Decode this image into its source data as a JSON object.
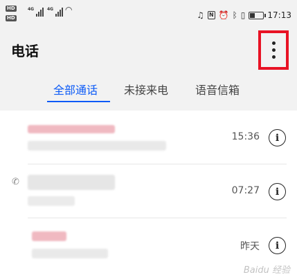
{
  "status_bar": {
    "left_labels": {
      "hd1": "HD",
      "hd2": "HD",
      "net1": "4G",
      "net2": "4G"
    },
    "icons": [
      "headset-icon",
      "nfc-icon",
      "alarm-icon",
      "bluetooth-icon",
      "vibrate-icon",
      "battery-icon"
    ],
    "battery_level": 0.4,
    "time": "17:13"
  },
  "header": {
    "title": "电话",
    "more_icon": "more-vertical-icon",
    "highlight_color": "#e81224"
  },
  "tabs": [
    {
      "label": "全部通话",
      "active": true
    },
    {
      "label": "未接来电",
      "active": false
    },
    {
      "label": "语音信箱",
      "active": false
    }
  ],
  "accent_color": "#0a59f7",
  "calls": [
    {
      "time": "15:36",
      "info_icon": "info-icon"
    },
    {
      "time": "07:27",
      "info_icon": "info-icon",
      "call_icon": "outgoing-call-icon"
    },
    {
      "time": "昨天",
      "info_icon": "info-icon"
    }
  ],
  "watermark": "Baidu 经验"
}
